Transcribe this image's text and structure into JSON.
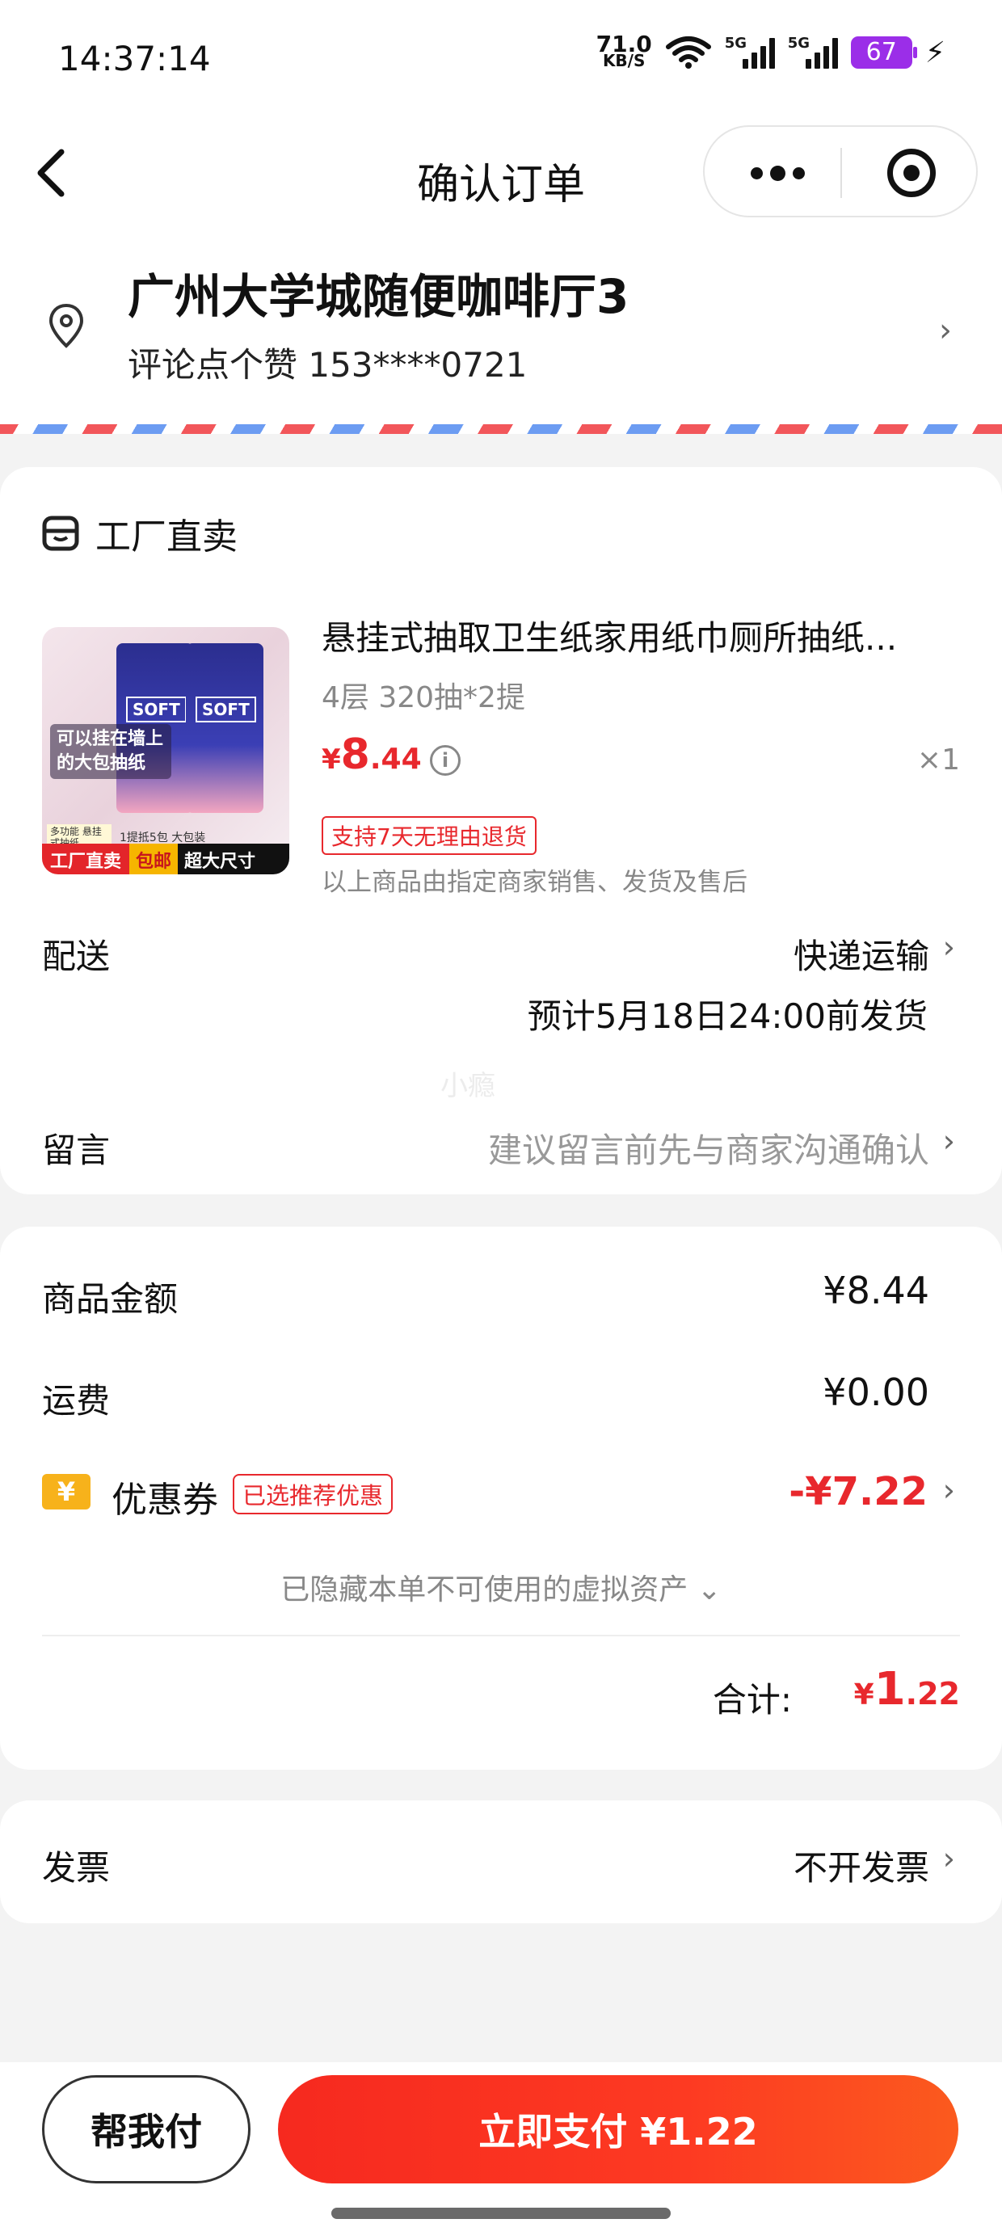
{
  "status_bar": {
    "time": "14:37:14",
    "net_speed_value": "71.0",
    "net_speed_unit": "KB/S",
    "signal1": "5G",
    "signal2": "5G",
    "battery": "67"
  },
  "nav": {
    "title": "确认订单"
  },
  "address": {
    "name": "广州大学城随便咖啡厅3",
    "contact": "评论点个赞 153****0721"
  },
  "shop": {
    "name": "工厂直卖"
  },
  "product": {
    "title": "悬挂式抽取卫生纸家用纸巾厕所抽纸...",
    "spec": "4层 320抽*2提",
    "price_currency": "¥",
    "price_int": "8",
    "price_dec": ".44",
    "qty": "×1",
    "return_badge": "支持7天无理由退货",
    "seller_note": "以上商品由指定商家销售、发货及售后",
    "image_texts": {
      "pack": "SOFT",
      "hang": "可以挂在墙上的大包抽纸",
      "mini": "多功能 悬挂式抽纸",
      "pack_info": "1提抵5包 大包装",
      "strip_a": "工厂直卖",
      "strip_b": "包邮",
      "strip_c": "超大尺寸"
    }
  },
  "delivery": {
    "label": "配送",
    "value": "快递运输",
    "eta": "预计5月18日24:00前发货"
  },
  "watermark": "小瘾",
  "message": {
    "label": "留言",
    "placeholder": "建议留言前先与商家沟通确认"
  },
  "summary": {
    "goods_label": "商品金额",
    "goods_value": "¥8.44",
    "shipping_label": "运费",
    "shipping_value": "¥0.00",
    "coupon_icon": "¥",
    "coupon_label": "优惠券",
    "coupon_badge": "已选推荐优惠",
    "coupon_value": "-¥7.22",
    "hidden_assets": "已隐藏本单不可使用的虚拟资产 ⌄",
    "total_label": "合计:",
    "total_currency": "¥",
    "total_int": "1",
    "total_dec": ".22"
  },
  "invoice": {
    "label": "发票",
    "value": "不开发票"
  },
  "bottom": {
    "help_pay": "帮我付",
    "pay_now": "立即支付 ¥1.22"
  },
  "colors": {
    "accent_red": "#e8282d",
    "pay_gradient_start": "#f6291f",
    "pay_gradient_end": "#fb5a1e",
    "battery": "#9b2ee8",
    "coupon_icon": "#f7b21b"
  },
  "icons": [
    "back-arrow-icon",
    "more-dots-icon",
    "target-icon",
    "location-pin-icon",
    "shop-icon",
    "info-icon",
    "chevron-right-icon",
    "coupon-icon",
    "wifi-icon",
    "signal-icon",
    "battery-icon",
    "charging-icon"
  ]
}
